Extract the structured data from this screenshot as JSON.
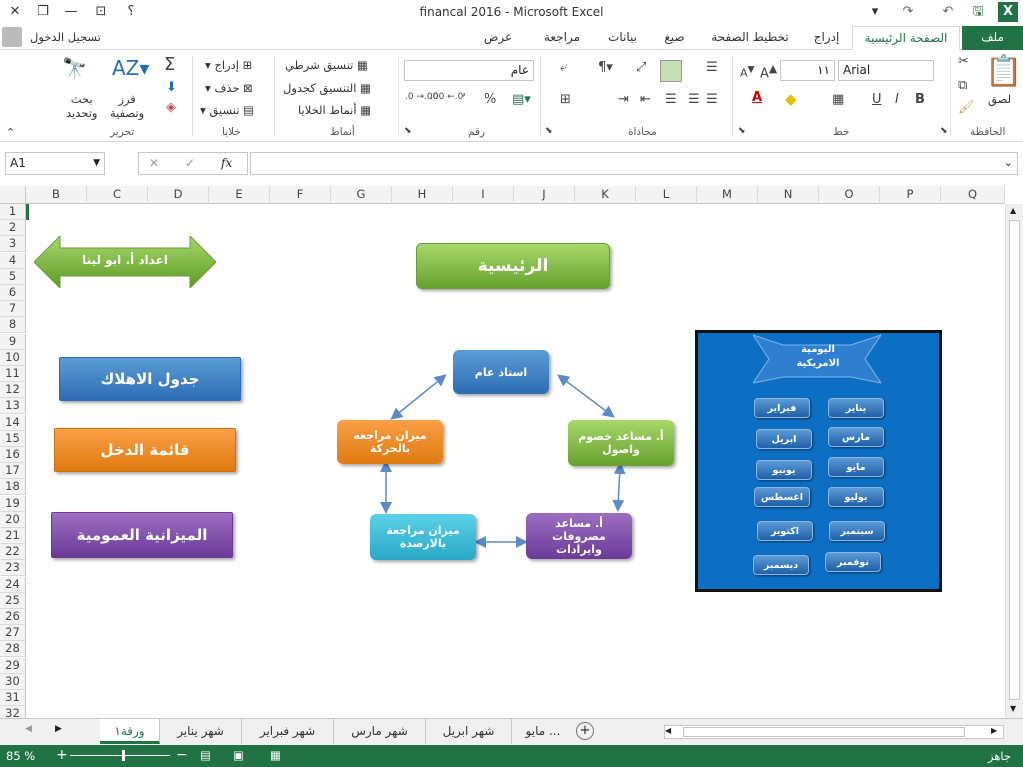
{
  "window": {
    "title": "financal 2016 - Microsoft Excel",
    "help": "؟"
  },
  "user": {
    "signin": "تسجيل الدخول"
  },
  "tabs": [
    "ملف",
    "الصفحة الرئيسية",
    "إدراج",
    "تخطيط الصفحة",
    "صيغ",
    "بيانات",
    "مراجعة",
    "عرض"
  ],
  "ribbon": {
    "clipboard": {
      "paste": "لصق",
      "label": "الحافظة"
    },
    "font": {
      "name": "Arial",
      "size": "١١",
      "label": "خط",
      "bold": "B",
      "italic": "I",
      "underline": "U"
    },
    "alignment": {
      "label": "محاذاة"
    },
    "number": {
      "format": "عام",
      "label": "رقم",
      "percent": "%",
      "comma": "٬",
      "dec_inc": ".00 ←.0",
      "dec_dec": ".0 →.00"
    },
    "styles": {
      "cond": "تنسيق شرطي",
      "table": "التنسيق كجدول",
      "cell": "أنماط الخلايا",
      "label": "أنماط"
    },
    "cells": {
      "insert": "إدراج",
      "delete": "حذف",
      "format": "تنسيق",
      "label": "خلايا"
    },
    "editing": {
      "sort": "فرز\nوتصفية",
      "find": "بحث\nوتحديد",
      "label": "تحرير",
      "sum": "Σ"
    }
  },
  "formula_bar": {
    "name_box": "A1",
    "fx": "fx",
    "value": ""
  },
  "columns": [
    "B",
    "C",
    "D",
    "E",
    "F",
    "G",
    "H",
    "I",
    "J",
    "K",
    "L",
    "M",
    "N",
    "O",
    "P",
    "Q"
  ],
  "rows": [
    "1",
    "2",
    "3",
    "4",
    "5",
    "6",
    "7",
    "8",
    "9",
    "10",
    "11",
    "12",
    "13",
    "14",
    "15",
    "16",
    "17",
    "18",
    "19",
    "20",
    "21",
    "22",
    "23",
    "24",
    "25",
    "26",
    "27",
    "28",
    "29",
    "30",
    "31",
    "32"
  ],
  "shapes": {
    "author": "اعداد أ. ابو لينا",
    "home": "الرئيسية",
    "depreciation": "جدول الاهلاك",
    "income": "قائمة الدخل",
    "budget": "الميزانية العمومية",
    "general_ledger": "استاذ عام",
    "trial_movement": "ميزان مراجعه بالحركة",
    "trial_balance": "ميزان مراجعة بالارصدة",
    "asst_liab": "أ. مساعد خصوم واصول",
    "asst_exp": "أ. مساعد مصروفات وايرادات"
  },
  "journal": {
    "title": "اليومية الامريكية",
    "months": [
      "يناير",
      "فبراير",
      "مارس",
      "ابريل",
      "مايو",
      "يونيو",
      "يوليو",
      "اغسطس",
      "سبتمبر",
      "اكتوبر",
      "نوفمبر",
      "ديسمبر"
    ]
  },
  "sheets": [
    "ورقة١",
    "شهر يناير",
    "شهر فبراير",
    "شهر مارس",
    "شهر ابريل",
    "مايو ..."
  ],
  "status": {
    "ready": "جاهز",
    "zoom": "85 %"
  },
  "colors": {
    "accent": "#217346",
    "journal_bg": "#0d6fc4"
  }
}
